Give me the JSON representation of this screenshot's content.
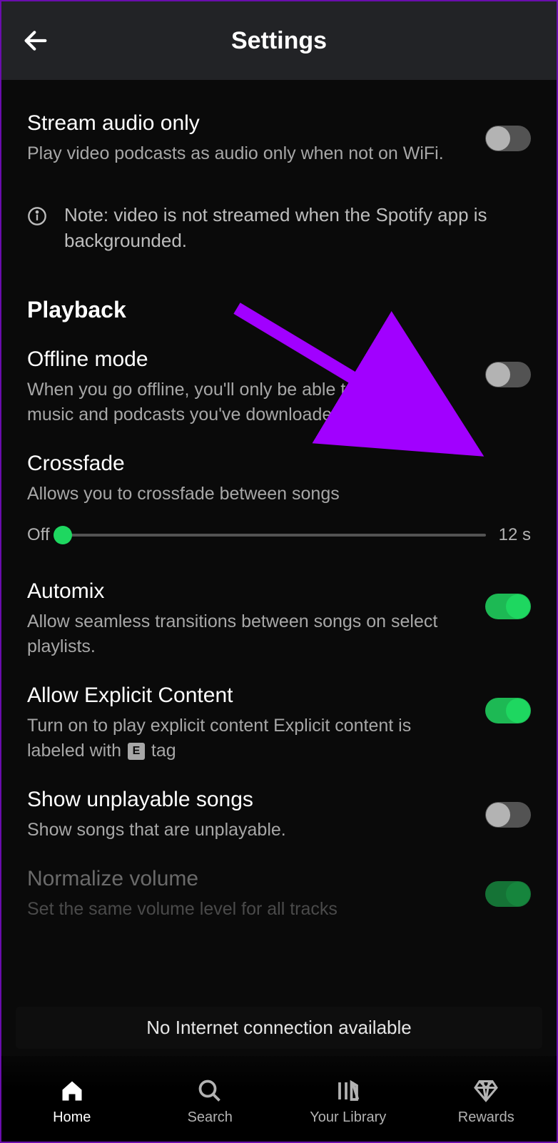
{
  "header": {
    "title": "Settings"
  },
  "settings": {
    "stream_audio_only": {
      "title": "Stream audio only",
      "desc": "Play video podcasts as audio only when not on WiFi.",
      "value": false
    },
    "note": "Note: video is not streamed when the Spotify app is backgrounded.",
    "section_playback": "Playback",
    "offline_mode": {
      "title": "Offline mode",
      "desc": "When you go offline, you'll only be able to play the music and podcasts you've downloaded.",
      "value": false
    },
    "crossfade": {
      "title": "Crossfade",
      "desc": "Allows you to crossfade between songs",
      "min_label": "Off",
      "max_label": "12 s",
      "value": 0
    },
    "automix": {
      "title": "Automix",
      "desc": "Allow seamless transitions between songs on select playlists.",
      "value": true
    },
    "explicit": {
      "title": "Allow Explicit Content",
      "desc_pre": "Turn on to play explicit content Explicit content is labeled with ",
      "desc_post": " tag",
      "tag": "E",
      "value": true
    },
    "unplayable": {
      "title": "Show unplayable songs",
      "desc": "Show songs that are unplayable.",
      "value": false
    },
    "normalize": {
      "title": "Normalize volume",
      "desc": "Set the same volume level for all tracks",
      "value": true
    }
  },
  "toast": "No Internet connection available",
  "nav": {
    "home": "Home",
    "search": "Search",
    "library": "Your Library",
    "rewards": "Rewards"
  },
  "annotation": {
    "arrow_color": "#a100ff"
  }
}
